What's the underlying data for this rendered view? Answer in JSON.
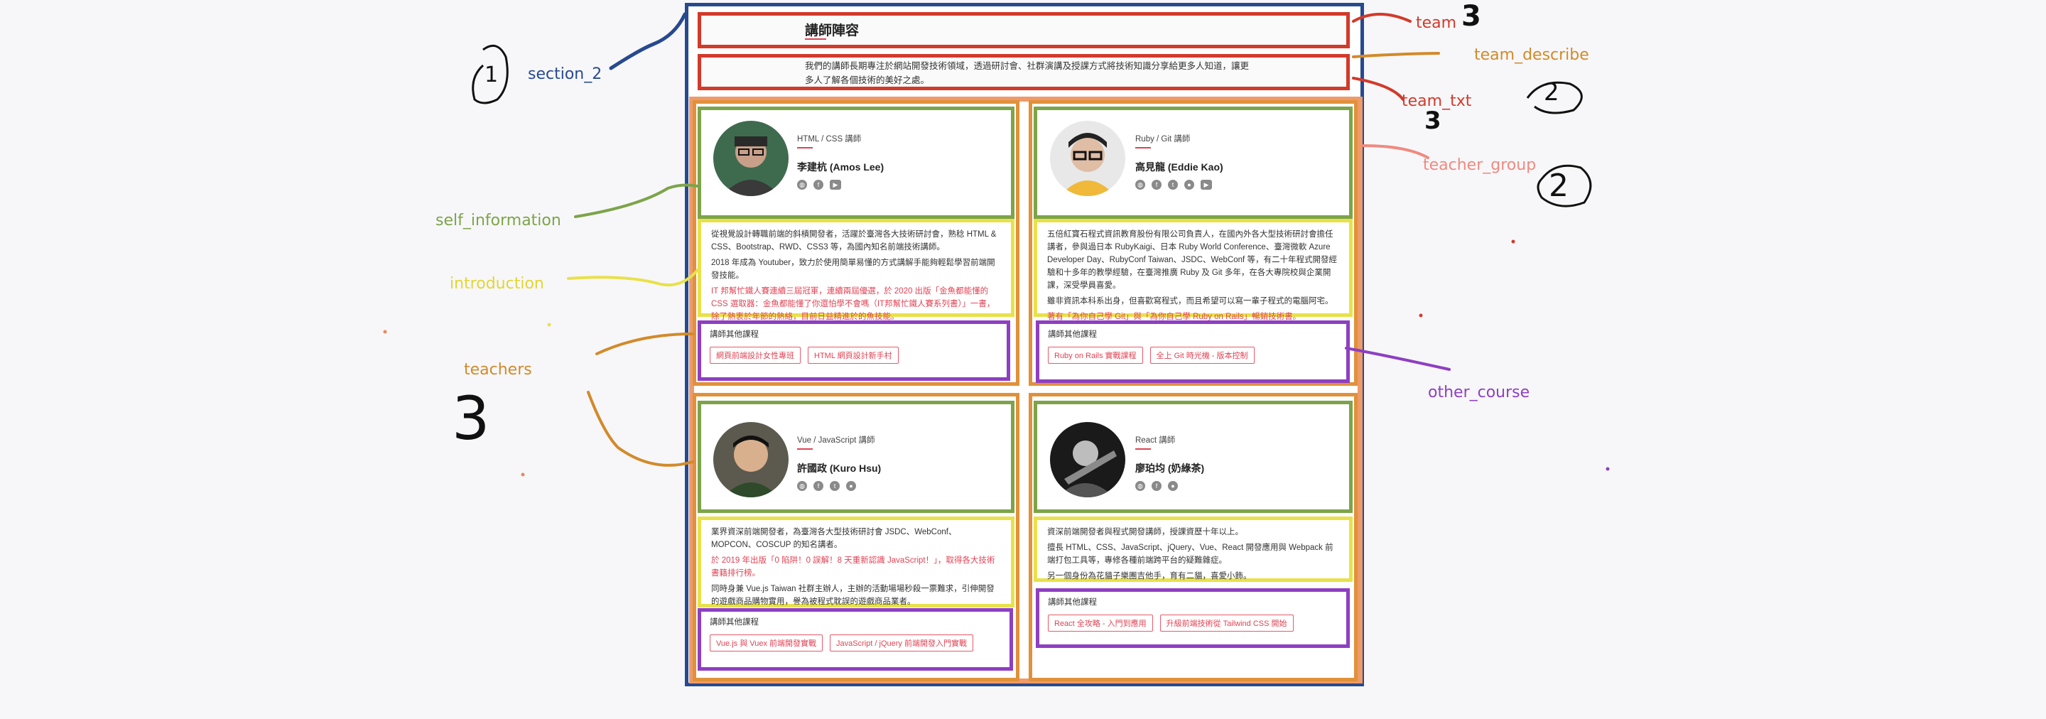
{
  "annotations": {
    "section_2": "section_2",
    "team": "team",
    "team_describe": "team_describe",
    "team_txt": "team_txt",
    "teacher_group": "teacher_group",
    "self_information": "self_information",
    "introduction": "introduction",
    "teachers": "teachers",
    "other_course": "other_course",
    "count_section": "1",
    "count_team": "3",
    "count_team_txt": "3",
    "count_teacher_group": "2",
    "count_teacher_group_2": "2",
    "count_teachers": "3"
  },
  "colors": {
    "section_2": "#274a8e",
    "team": "#d23a2a",
    "team_describe": "#d28a2a",
    "teacher_group": "#ef9a6a",
    "teachers": "#e0913a",
    "self_information": "#7da44a",
    "introduction": "#e9e14a",
    "other_course": "#8e3fc2"
  },
  "page": {
    "title": "講師陣容",
    "description": "我們的講師長期專注於網站開發技術領域，透過研討會、社群演講及授課方式將技術知識分享給更多人知道，讓更多人了解各個技術的美好之處。",
    "other_course_label": "講師其他課程"
  },
  "teachers": [
    {
      "role": "HTML / CSS 講師",
      "name": "李建杭 (Amos Lee)",
      "icons": [
        "globe-icon",
        "facebook-icon",
        "youtube-icon"
      ],
      "intro": [
        "從視覺設計轉職前端的斜槓開發者，活躍於臺灣各大技術研討會，熟稔 HTML & CSS、Bootstrap、RWD、CSS3 等，為國內知名前端技術講師。",
        "2018 年成為 Youtuber，致力於使用簡單易懂的方式講解手能夠輕鬆學習前端開發技能。",
        "IT 邦幫忙鐵人賽連續三屆冠軍，連續兩屆優選，於 2020 出版「金魚都能懂的 CSS 選取器：金魚都能懂了你還怕學不會嗎（IT邦幫忙鐵人賽系列書）」一書，除了熱衷於年節的熱絡，目前日益精進於的魚技能。"
      ],
      "courses": [
        "網頁前端設計女性專班",
        "HTML 網頁設計新手村"
      ]
    },
    {
      "role": "Ruby / Git 講師",
      "name": "高見龍 (Eddie Kao)",
      "icons": [
        "globe-icon",
        "facebook-icon",
        "twitter-icon",
        "github-icon",
        "youtube-icon"
      ],
      "intro": [
        "五倍紅寶石程式資訊教育股份有限公司負責人，在國內外各大型技術研討會擔任講者，參與過日本 RubyKaigi、日本 Ruby World Conference、臺灣微軟 Azure Developer Day、RubyConf Taiwan、JSDC、WebConf 等，有二十年程式開發經驗和十多年的教學經驗，在臺灣推廣 Ruby 及 Git 多年，在各大專院校與企業開課，深受學員喜愛。",
        "雖非資訊本科系出身，但喜歡寫程式，而且希望可以寫一輩子程式的電腦阿宅。",
        "著有「為你自己學 Git」與「為你自己學 Ruby on Rails」暢銷技術書。"
      ],
      "courses": [
        "Ruby on Rails 實戰課程",
        "全上 Git 時光機 - 版本控制"
      ]
    },
    {
      "role": "Vue / JavaScript 講師",
      "name": "許國政 (Kuro Hsu)",
      "icons": [
        "globe-icon",
        "facebook-icon",
        "twitter-icon",
        "github-icon"
      ],
      "intro": [
        "業界資深前端開發者，為臺灣各大型技術研討會 JSDC、WebConf、MOPCON、COSCUP 的知名講者。",
        "於 2019 年出版「0 陷阱！0 誤解！8 天重新認識 JavaScript！」，取得各大技術書籍排行榜。",
        "同時身兼 Vue.js Taiwan 社群主辦人，主辦的活動場場秒殺一票難求，引伸開發的遊戲商品購物實用，譽為被程式耽誤的遊戲商品業者。"
      ],
      "courses": [
        "Vue.js 與 Vuex 前端開發實戰",
        "JavaScript / jQuery 前端開發入門實戰"
      ]
    },
    {
      "role": "React 講師",
      "name": "廖珀均 (奶綠茶)",
      "icons": [
        "globe-icon",
        "facebook-icon",
        "github-icon"
      ],
      "intro": [
        "資深前端開發者與程式開發講師，授課資歷十年以上。",
        "擅長 HTML、CSS、JavaScript、jQuery、Vue、React 開發應用與 Webpack 前端打包工具等，專修各種前端跨平台的疑難雜症。",
        "另一個身份為花貓子樂團吉他手，育有二貓，喜愛小飾。"
      ],
      "courses": [
        "React 全攻略 - 入門到應用",
        "升級前端技術從 Tailwind CSS 開始"
      ]
    }
  ]
}
